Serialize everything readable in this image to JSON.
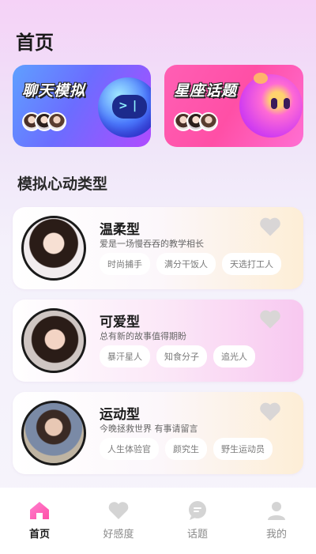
{
  "page": {
    "title": "首页"
  },
  "banners": [
    {
      "title": "聊天模拟",
      "face": ">  |"
    },
    {
      "title": "星座话题"
    }
  ],
  "section": {
    "title": "模拟心动类型"
  },
  "types": [
    {
      "name": "温柔型",
      "desc": "爱是一场慢吞吞的教学相长",
      "tags": [
        "时尚捕手",
        "满分干饭人",
        "天选打工人"
      ]
    },
    {
      "name": "可爱型",
      "desc": "总有新的故事值得期盼",
      "tags": [
        "暴汗星人",
        "知食分子",
        "追光人"
      ]
    },
    {
      "name": "运动型",
      "desc": "今晚拯救世界 有事请留言",
      "tags": [
        "人生体验官",
        "颜究生",
        "野生运动员"
      ]
    }
  ],
  "nav": [
    {
      "label": "首页",
      "icon": "home-icon",
      "active": true
    },
    {
      "label": "好感度",
      "icon": "heart-icon",
      "active": false
    },
    {
      "label": "话题",
      "icon": "chat-icon",
      "active": false
    },
    {
      "label": "我的",
      "icon": "user-icon",
      "active": false
    }
  ],
  "colors": {
    "accent": "#ff4fa6",
    "inactive_icon": "#d4d4d4",
    "active_icon": "#ff5fb0"
  }
}
